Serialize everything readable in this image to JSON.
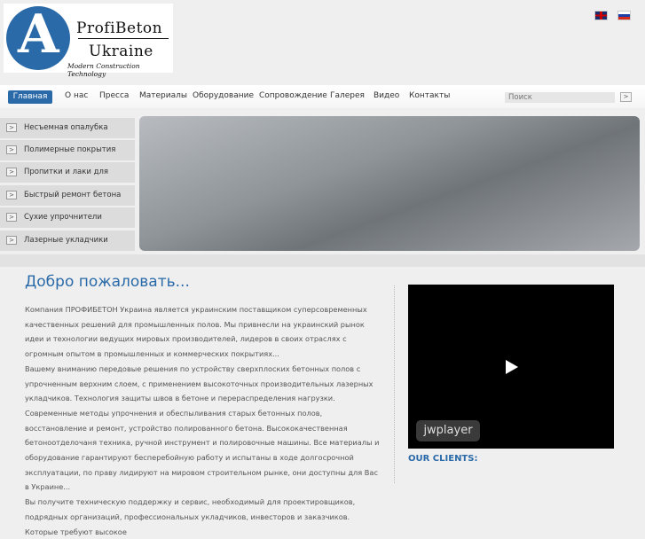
{
  "logo": {
    "line1": "ProfiBeton",
    "line2": "Ukraine",
    "tagline": "Modern Construction Technology"
  },
  "languages": [
    "English",
    "Русский"
  ],
  "nav": {
    "items": [
      "Главная",
      "О нас",
      "Пресса",
      "Материалы",
      "Оборудование",
      "Сопровождение",
      "Галерея",
      "Видео",
      "Контакты"
    ],
    "search_placeholder": "Поиск",
    "search_button": ">"
  },
  "sidebar": {
    "items": [
      "Несъемная опалубка",
      "Полимерные покрытия",
      "Пропитки и лаки для бетона",
      "Быстрый ремонт бетона",
      "Сухие упрочнители",
      "Лазерные укладчики"
    ],
    "arrow": ">"
  },
  "main": {
    "title": "Добро пожаловать...",
    "paragraphs": [
      "Компания ПРОФИБЕТОН Украина является украинским поставщиком суперсовременных качественных решений для промышленных полов. Мы привнесли на украинский рынок идеи и технологии ведущих мировых производителей, лидеров в своих отраслях с огромным опытом в промышленных и коммерческих покрытиях...",
      "Вашему вниманию передовые решения по устройству сверхплоских бетонных полов с упрочненным верхним слоем, с применением высокоточных производительных лазерных укладчиков. Технология защиты швов в бетоне и перераспределения нагрузки. Современные методы упрочнения и обеспыливания старых бетонных полов, восстановление и ремонт, устройство полированного бетона. Высококачественная бетоноотделочаня техника, ручной инструмент и полировочные машины. Все материалы и оборудование гарантируют бесперебойную работу и испытаны в ходе долгосрочной эксплуатации, по праву лидируют на мировом строительном рынке, они доступны для Вас в Украине...",
      "Вы получите техническую поддержку и сервис, необходимый для проектировщиков, подрядных организаций, профессиональных укладчиков, инвесторов и заказчиков. Которые требуют высокое"
    ]
  },
  "video": {
    "player_label": "jwplayer"
  },
  "clients": {
    "title": "OUR CLIENTS:"
  }
}
